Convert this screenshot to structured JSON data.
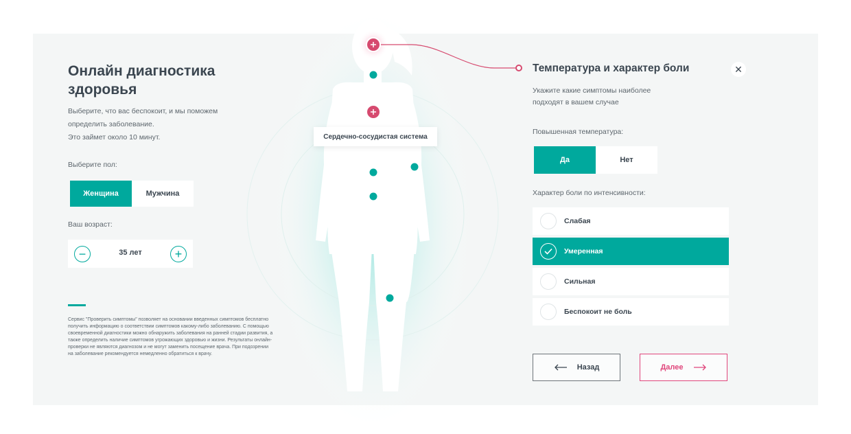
{
  "intro": {
    "title": "Онлайн диагностика здоровья",
    "lines": [
      "Выберите, что вас беспокоит, и мы поможем",
      "определить заболевание.",
      "Это займет около 10 минут."
    ]
  },
  "gender": {
    "label": "Выберите пол:",
    "options": [
      "Женщина",
      "Мужчина"
    ],
    "selected": "Женщина"
  },
  "age": {
    "label": "Ваш возраст:",
    "value": "35 лет",
    "minus": "−",
    "plus": "+"
  },
  "disclaimer": "Сервис \"Проверить симптомы\" позволяет на основании введенных симптомов бесплатно получить информацию о соответствии симптомов какому-либо заболеванию. С помощью своевременной диагностики можно обнаружить заболевания на ранней стадии развития, а также определить наличие симптомов угрожающих здоровью и жизни. Результаты онлайн-проверки не являются диагнозом и не могут заменить посещение врача. При подозрении на заболевание рекомендуется немедленно обратиться к врачу.",
  "figure": {
    "tooltip": "Сердечно-сосудистая система"
  },
  "panel": {
    "title": "Температура и характер боли",
    "close": "✕",
    "subtitle_lines": [
      "Укажите какие симптомы наиболее",
      "подходят в вашем случае"
    ],
    "temperature": {
      "label": "Повышенная температура:",
      "options": [
        "Да",
        "Нет"
      ],
      "selected": "Да"
    },
    "pain": {
      "label": "Характер боли по интенсивности:",
      "options": [
        "Слабая",
        "Умеренная",
        "Сильная",
        "Беспокоит не боль"
      ],
      "selected": "Умеренная"
    },
    "back": "Назад",
    "next": "Далее"
  },
  "colors": {
    "accent": "#00a99d",
    "alert": "#e0457b",
    "panel": "#f4f6f6",
    "text": "#3b4650"
  }
}
